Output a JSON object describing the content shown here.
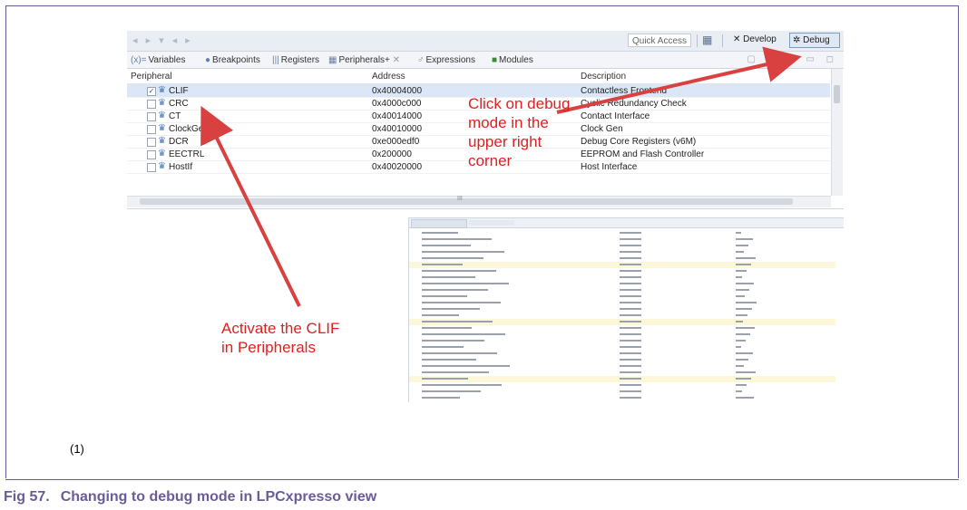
{
  "toolbar": {
    "quick_access": "Quick Access",
    "develop_label": "Develop",
    "debug_label": "Debug"
  },
  "tabs": [
    {
      "icon": "(x)=",
      "label": "Variables"
    },
    {
      "icon": "●",
      "label": "Breakpoints"
    },
    {
      "icon": "|||",
      "label": "Registers"
    },
    {
      "icon": "▦",
      "label": "Peripherals+"
    },
    {
      "icon": "♂",
      "label": "Expressions"
    },
    {
      "icon": "■",
      "label": "Modules"
    }
  ],
  "peripherals": {
    "headers": {
      "peripheral": "Peripheral",
      "address": "Address",
      "description": "Description"
    },
    "rows": [
      {
        "name": "CLIF",
        "address": "0x40004000",
        "description": "Contactless Frontend",
        "checked": true
      },
      {
        "name": "CRC",
        "address": "0x4000c000",
        "description": "Cyclic Redundancy Check",
        "checked": false
      },
      {
        "name": "CT",
        "address": "0x40014000",
        "description": "Contact Interface",
        "checked": false
      },
      {
        "name": "ClockGen",
        "address": "0x40010000",
        "description": "Clock Gen",
        "checked": false
      },
      {
        "name": "DCR",
        "address": "0xe000edf0",
        "description": "Debug Core Registers (v6M)",
        "checked": false
      },
      {
        "name": "EECTRL",
        "address": "0x200000",
        "description": "EEPROM and Flash Controller",
        "checked": false
      },
      {
        "name": "HostIf",
        "address": "0x40020000",
        "description": "Host Interface",
        "checked": false
      }
    ],
    "check_mark": "✓",
    "hscroll_marker": "III"
  },
  "annotations": {
    "debug_note": [
      "Click on debug",
      "mode in the",
      "upper right",
      "corner"
    ],
    "clif_note": [
      "Activate the CLIF",
      "in Peripherals"
    ]
  },
  "caption_number": "(1)",
  "figure": {
    "number": "Fig 57.",
    "title": "Changing to debug mode in LPCxpresso view"
  },
  "colors": {
    "annotation": "#e02020",
    "caption": "#6c5b9b"
  }
}
